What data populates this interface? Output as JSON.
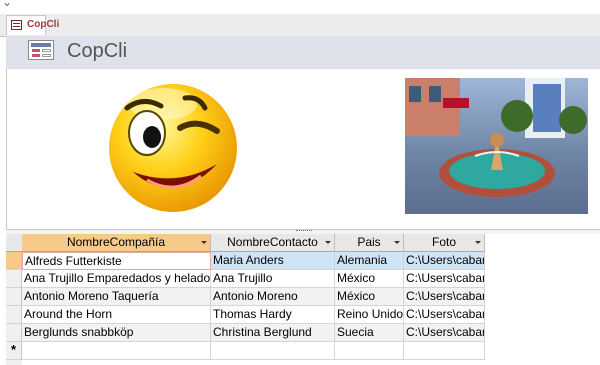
{
  "tab": {
    "label": "CopCli"
  },
  "header": {
    "title": "CopCli"
  },
  "table": {
    "columns": [
      "NombreCompañía",
      "NombreContacto",
      "Pais",
      "Foto"
    ],
    "rows": [
      [
        "Alfreds Futterkiste",
        "Maria Anders",
        "Alemania",
        "C:\\Users\\cabar"
      ],
      [
        "Ana Trujillo Emparedados y helados",
        "Ana Trujillo",
        "México",
        "C:\\Users\\cabar"
      ],
      [
        "Antonio Moreno Taquería",
        "Antonio Moreno",
        "México",
        "C:\\Users\\cabar"
      ],
      [
        "Around the Horn",
        "Thomas Hardy",
        "Reino Unido",
        "C:\\Users\\cabar"
      ],
      [
        "Berglunds snabbköp",
        "Christina Berglund",
        "Suecia",
        "C:\\Users\\cabar"
      ]
    ],
    "new_row_marker": "*"
  },
  "colors": {
    "accent": "#a4373a",
    "header_band": "#dfe2ea",
    "selection": "#f7ca8a",
    "current_row": "#cfe4f7"
  },
  "icons": [
    "form-icon",
    "table-form-tab-icon",
    "smiley-wink-image",
    "fountain-photo"
  ]
}
